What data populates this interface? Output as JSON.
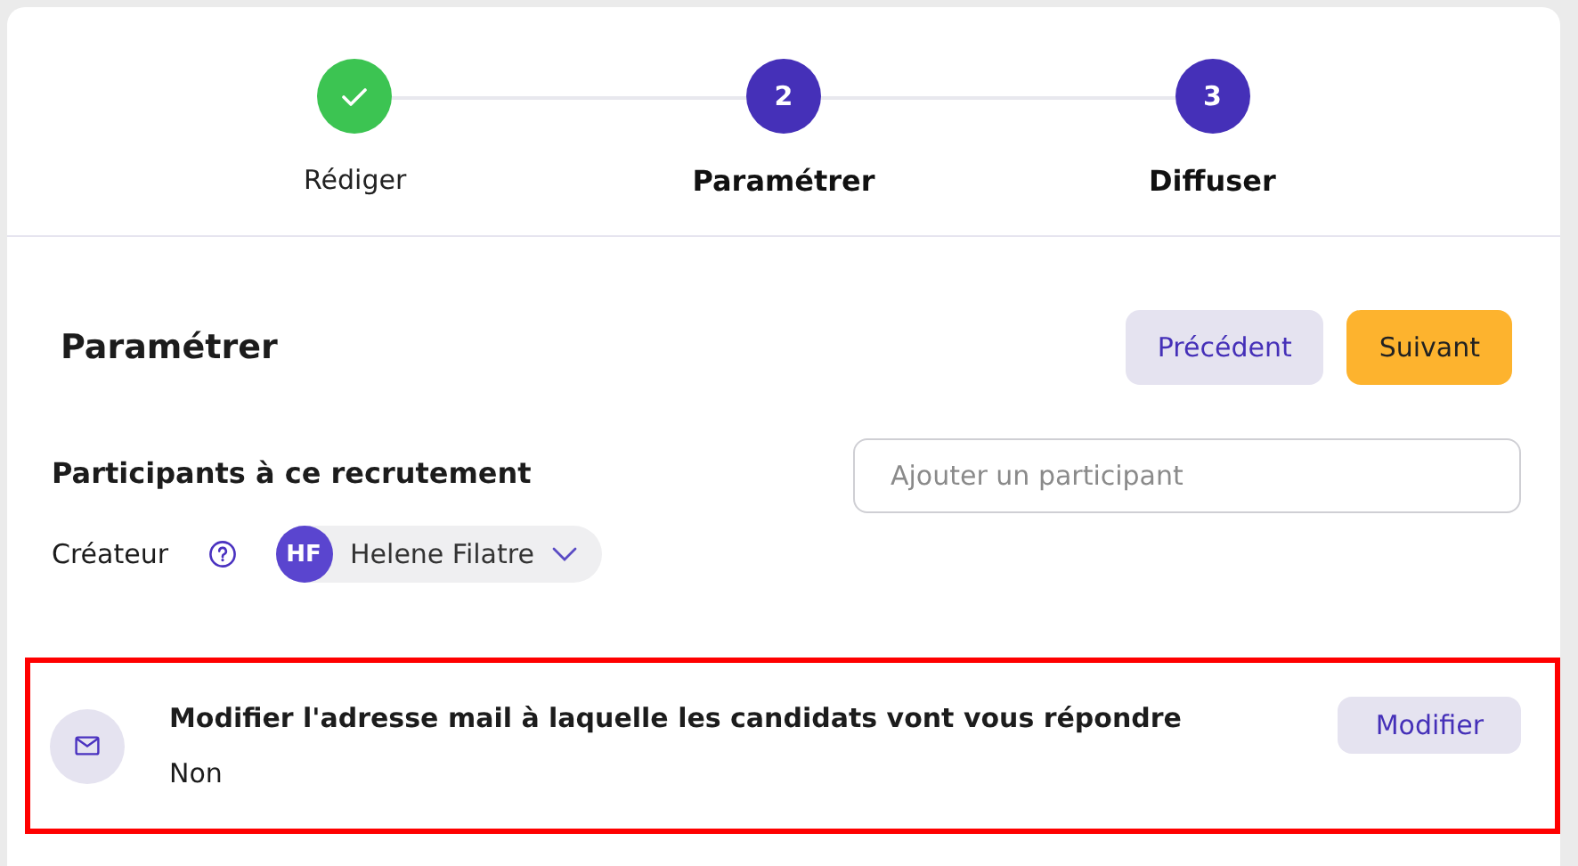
{
  "steps": [
    {
      "label": "Rédiger",
      "done": true
    },
    {
      "number": "2",
      "label": "Paramétrer",
      "done": false
    },
    {
      "number": "3",
      "label": "Diffuser",
      "done": false
    }
  ],
  "heading": "Paramétrer",
  "buttons": [
    {
      "label": "Précédent",
      "kind": "secondary"
    },
    {
      "label": "Suivant",
      "kind": "primary"
    }
  ],
  "participants": {
    "title": "Participants à ce recrutement",
    "creator_label": "Créateur",
    "creator": {
      "initials": "HF",
      "name": "Helene Filatre"
    },
    "search": {
      "placeholder": "Ajouter un participant"
    }
  },
  "email_setting": {
    "title": "Modifier l'adresse mail à laquelle les candidats vont vous répondre",
    "value": "Non",
    "button": "Modifier",
    "highlighted": true
  }
}
